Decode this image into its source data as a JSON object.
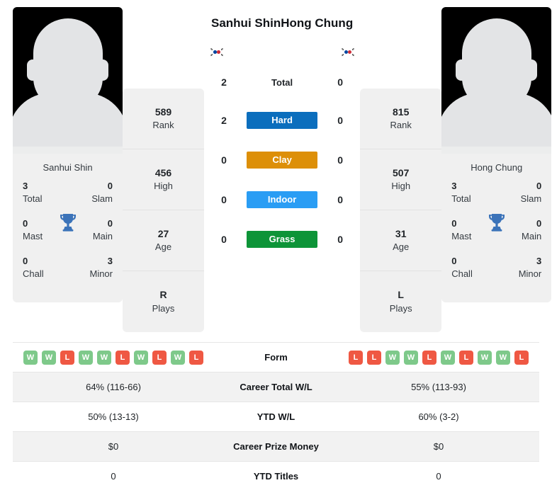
{
  "players": {
    "left": {
      "name": "Sanhui Shin",
      "caption": "Sanhui Shin",
      "flag": "south-korea-flag",
      "card": [
        {
          "value": "589",
          "label": "Rank"
        },
        {
          "value": "456",
          "label": "High"
        },
        {
          "value": "27",
          "label": "Age"
        },
        {
          "value": "R",
          "label": "Plays"
        }
      ],
      "titles": [
        {
          "value": "3",
          "label": "Total"
        },
        {
          "value": "0",
          "label": "Slam"
        },
        {
          "value": "0",
          "label": "Mast"
        },
        {
          "value": "0",
          "label": "Main"
        },
        {
          "value": "0",
          "label": "Chall"
        },
        {
          "value": "3",
          "label": "Minor"
        }
      ],
      "form": [
        "W",
        "W",
        "L",
        "W",
        "W",
        "L",
        "W",
        "L",
        "W",
        "L"
      ]
    },
    "right": {
      "name": "Hong Chung",
      "caption": "Hong Chung",
      "flag": "south-korea-flag",
      "card": [
        {
          "value": "815",
          "label": "Rank"
        },
        {
          "value": "507",
          "label": "High"
        },
        {
          "value": "31",
          "label": "Age"
        },
        {
          "value": "L",
          "label": "Plays"
        }
      ],
      "titles": [
        {
          "value": "3",
          "label": "Total"
        },
        {
          "value": "0",
          "label": "Slam"
        },
        {
          "value": "0",
          "label": "Mast"
        },
        {
          "value": "0",
          "label": "Main"
        },
        {
          "value": "0",
          "label": "Chall"
        },
        {
          "value": "3",
          "label": "Minor"
        }
      ],
      "form": [
        "L",
        "L",
        "W",
        "W",
        "L",
        "W",
        "L",
        "W",
        "W",
        "L"
      ]
    }
  },
  "h2h": [
    {
      "label": "Total",
      "left": "2",
      "right": "0",
      "style": "plain",
      "color": ""
    },
    {
      "label": "Hard",
      "left": "2",
      "right": "0",
      "style": "pill",
      "color": "#0b6ebd"
    },
    {
      "label": "Clay",
      "left": "0",
      "right": "0",
      "style": "pill",
      "color": "#dd8f08"
    },
    {
      "label": "Indoor",
      "left": "0",
      "right": "0",
      "style": "pill",
      "color": "#2a9df4"
    },
    {
      "label": "Grass",
      "left": "0",
      "right": "0",
      "style": "pill",
      "color": "#0d9438"
    }
  ],
  "table": {
    "form_label": "Form",
    "rows": [
      {
        "label": "Career Total W/L",
        "left": "64% (116-66)",
        "right": "55% (113-93)"
      },
      {
        "label": "YTD W/L",
        "left": "50% (13-13)",
        "right": "60% (3-2)"
      },
      {
        "label": "Career Prize Money",
        "left": "$0",
        "right": "$0"
      },
      {
        "label": "YTD Titles",
        "left": "0",
        "right": "0"
      }
    ]
  },
  "colors": {
    "win": "#7ec98a",
    "loss": "#ef5843",
    "trophy": "#3b73b9",
    "panel": "#f0f0f0",
    "row_shaded": "#f2f2f2"
  }
}
